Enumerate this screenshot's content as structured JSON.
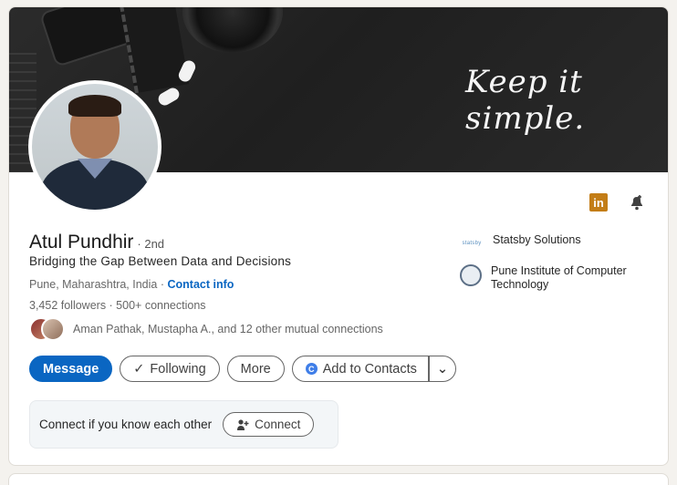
{
  "banner": {
    "tagline": "Keep it simple."
  },
  "profile": {
    "name": "Atul Pundhir",
    "degree": "· 2nd",
    "headline": "Bridging the Gap Between Data and Decisions",
    "location": "Pune, Maharashtra, India",
    "location_separator": " · ",
    "contact_info": "Contact info",
    "followers": "3,452 followers",
    "connections": " · 500+ connections",
    "mutual": "Aman Pathak, Mustapha A., and 12 other mutual connections"
  },
  "actions": {
    "message": "Message",
    "following": "Following",
    "following_icon": "✓",
    "more": "More",
    "add_to_contacts": "Add to Contacts",
    "contacts_icon": "C",
    "caret": "⌄"
  },
  "connect_prompt": {
    "text": "Connect if you know each other",
    "button": "Connect"
  },
  "orgs": [
    {
      "logo_text": "statsby",
      "name": "Statsby Solutions"
    },
    {
      "logo_text": "",
      "name": "Pune Institute of Computer Technology"
    }
  ],
  "icons": {
    "linkedin": "in",
    "linkedin_color": "#c37d16",
    "accent": "#0a66c2"
  }
}
